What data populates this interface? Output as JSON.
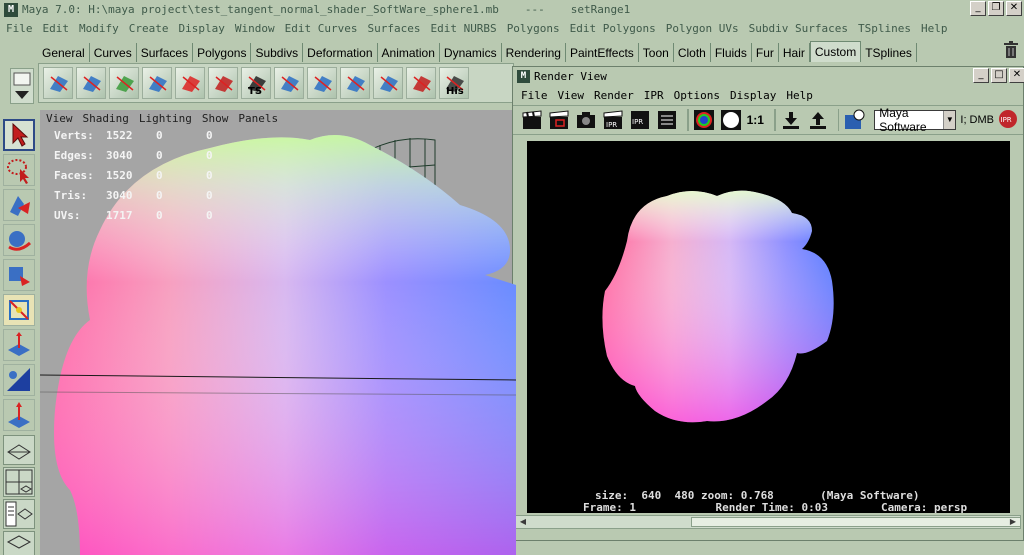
{
  "window": {
    "title": "Maya 7.0: H:\\maya project\\test_tangent_normal_shader_SoftWare_sphere1.mb",
    "title_sep": "---",
    "title_extra": "setRange1",
    "app_icon_glyph": "M"
  },
  "menubar": [
    "File",
    "Edit",
    "Modify",
    "Create",
    "Display",
    "Window",
    "Edit Curves",
    "Surfaces",
    "Edit NURBS",
    "Polygons",
    "Edit Polygons",
    "Polygon UVs",
    "Subdiv Surfaces",
    "TSplines",
    "Help"
  ],
  "shelf_tabs": [
    "General",
    "Curves",
    "Surfaces",
    "Polygons",
    "Subdivs",
    "Deformation",
    "Animation",
    "Dynamics",
    "Rendering",
    "PaintEffects",
    "Toon",
    "Cloth",
    "Fluids",
    "Fur",
    "Hair",
    "Custom",
    "TSplines"
  ],
  "shelf_active_tab": "Custom",
  "shelf_icons": [
    {
      "name": "nurbs-plane-icon"
    },
    {
      "name": "nurbs-surface-icon"
    },
    {
      "name": "poly-extrude-icon"
    },
    {
      "name": "poly-cone-icon"
    },
    {
      "name": "split-poly-icon"
    },
    {
      "name": "subdiv-curve-icon"
    },
    {
      "name": "ts-icon",
      "label": "TS"
    },
    {
      "name": "loft-icon"
    },
    {
      "name": "curve-icon"
    },
    {
      "name": "plane-arrow-icon"
    },
    {
      "name": "bend-icon"
    },
    {
      "name": "graph-icon"
    },
    {
      "name": "history-icon",
      "label": "His"
    }
  ],
  "viewport": {
    "menu": [
      "View",
      "Shading",
      "Lighting",
      "Show",
      "Panels"
    ],
    "hud": [
      {
        "key": "Verts:",
        "v": "1522",
        "a": "0",
        "b": "0"
      },
      {
        "key": "Edges:",
        "v": "3040",
        "a": "0",
        "b": "0"
      },
      {
        "key": "Faces:",
        "v": "1520",
        "a": "0",
        "b": "0"
      },
      {
        "key": "Tris:",
        "v": "3040",
        "a": "0",
        "b": "0"
      },
      {
        "key": "UVs:",
        "v": "1717",
        "a": "0",
        "b": "0"
      }
    ]
  },
  "render_view": {
    "title": "Render View",
    "menu": [
      "File",
      "View",
      "Render",
      "IPR",
      "Options",
      "Display",
      "Help"
    ],
    "scale_label": "1:1",
    "renderer": "Maya Software",
    "extra": "I; DMB",
    "ipr_label": "IPR",
    "info_line1": "size:  640  480 zoom: 0.768       (Maya Software)",
    "info_line2": "Frame: 1            Render Time: 0:03        Camera: persp"
  }
}
